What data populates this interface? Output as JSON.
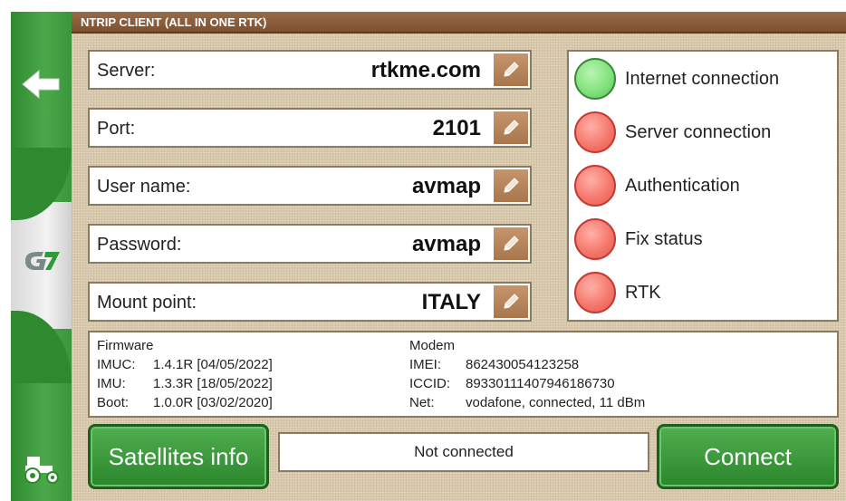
{
  "title": "NTRIP CLIENT (ALL IN ONE RTK)",
  "sidebar": {
    "back_icon": "back-arrow-icon",
    "logo_text": "G7",
    "tractor_icon": "tractor-icon"
  },
  "fields": [
    {
      "label": "Server:",
      "value": "rtkme.com"
    },
    {
      "label": "Port:",
      "value": "2101"
    },
    {
      "label": "User name:",
      "value": "avmap"
    },
    {
      "label": "Password:",
      "value": "avmap"
    },
    {
      "label": "Mount point:",
      "value": "ITALY"
    }
  ],
  "status": [
    {
      "label": "Internet connection",
      "state": "green"
    },
    {
      "label": "Server connection",
      "state": "red"
    },
    {
      "label": "Authentication",
      "state": "red"
    },
    {
      "label": "Fix status",
      "state": "red"
    },
    {
      "label": "RTK",
      "state": "red"
    }
  ],
  "firmware": {
    "heading": "Firmware",
    "rows": [
      {
        "key": "IMUC:",
        "value": "1.4.1R [04/05/2022]"
      },
      {
        "key": "IMU:",
        "value": "1.3.3R [18/05/2022]"
      },
      {
        "key": "Boot:",
        "value": "1.0.0R [03/02/2020]"
      }
    ]
  },
  "modem": {
    "heading": "Modem",
    "rows": [
      {
        "key": "IMEI:",
        "value": "862430054123258"
      },
      {
        "key": "ICCID:",
        "value": "89330111407946186730"
      },
      {
        "key": "Net:",
        "value": "vodafone, connected, 11 dBm"
      }
    ]
  },
  "buttons": {
    "satellites": "Satellites info",
    "connect": "Connect"
  },
  "connection_status": "Not connected",
  "colors": {
    "accent_green": "#3a9a3a",
    "title_brown": "#8a5a36",
    "led_green": "#7ee07a",
    "led_red": "#f47468"
  }
}
